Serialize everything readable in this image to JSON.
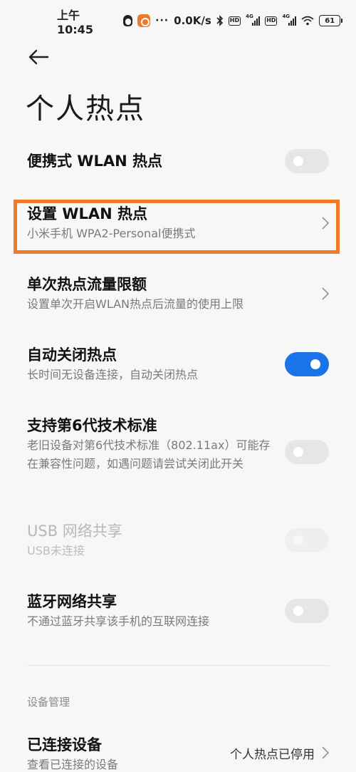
{
  "status_bar": {
    "time": "上午10:45",
    "dots": "···",
    "speed": "0.0K/s",
    "hd1": "HD",
    "net1": "4G",
    "hd2": "HD",
    "net2": "4G",
    "battery": "61"
  },
  "header": {
    "title": "个人热点"
  },
  "settings": {
    "portable_hotspot": {
      "title": "便携式 WLAN 热点",
      "enabled": false
    },
    "setup_hotspot": {
      "title": "设置 WLAN 热点",
      "subtitle": "小米手机 WPA2-Personal便携式"
    },
    "data_limit": {
      "title": "单次热点流量限额",
      "subtitle": "设置单次开启WLAN热点后流量的使用上限"
    },
    "auto_off": {
      "title": "自动关闭热点",
      "subtitle": "长时间无设备连接，自动关闭热点",
      "enabled": true
    },
    "wifi6": {
      "title": "支持第6代技术标准",
      "subtitle": "老旧设备对第6代技术标准（802.11ax）可能存在兼容性问题，如遇问题请尝试关闭此开关",
      "enabled": false
    },
    "usb_tether": {
      "title": "USB 网络共享",
      "subtitle": "USB未连接",
      "enabled": false
    },
    "bt_tether": {
      "title": "蓝牙网络共享",
      "subtitle": "不通过蓝牙共享该手机的互联网连接",
      "enabled": false
    }
  },
  "device_management": {
    "section_label": "设备管理",
    "connected_devices": {
      "title": "已连接设备",
      "subtitle": "查看已连接的设备",
      "value": "个人热点已停用"
    }
  },
  "colors": {
    "accent": "#1a73e8",
    "highlight": "#f07a2a",
    "background": "#f7f7f7"
  }
}
